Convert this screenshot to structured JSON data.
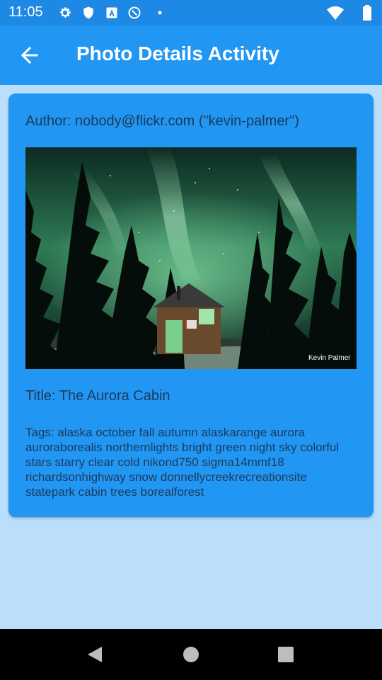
{
  "status_bar": {
    "time": "11:05",
    "icons": [
      "settings-icon",
      "shield-icon",
      "a-badge-icon",
      "at-sign-icon",
      "dot-icon",
      "wifi-icon",
      "battery-icon"
    ]
  },
  "app_bar": {
    "title": "Photo Details Activity",
    "back_icon": "arrow-back-icon"
  },
  "photo": {
    "author": "Author: nobody@flickr.com (\"kevin-palmer\")",
    "watermark": "Kevin Palmer",
    "title": "Title: The Aurora Cabin",
    "tags": "Tags: alaska october fall autumn alaskarange aurora auroraborealis northernlights bright green night sky colorful stars starry clear cold nikond750 sigma14mmf18 richardsonhighway snow donnellycreekrecreationsite statepark cabin trees borealforest"
  },
  "colors": {
    "status_bar": "#1e88e5",
    "app_bar": "#2196f3",
    "card": "#2196f3",
    "page_background": "#bbdefb",
    "text": "#1c3a5c"
  },
  "nav_bar": {
    "buttons": [
      "back-triangle-icon",
      "home-circle-icon",
      "recents-square-icon"
    ]
  }
}
